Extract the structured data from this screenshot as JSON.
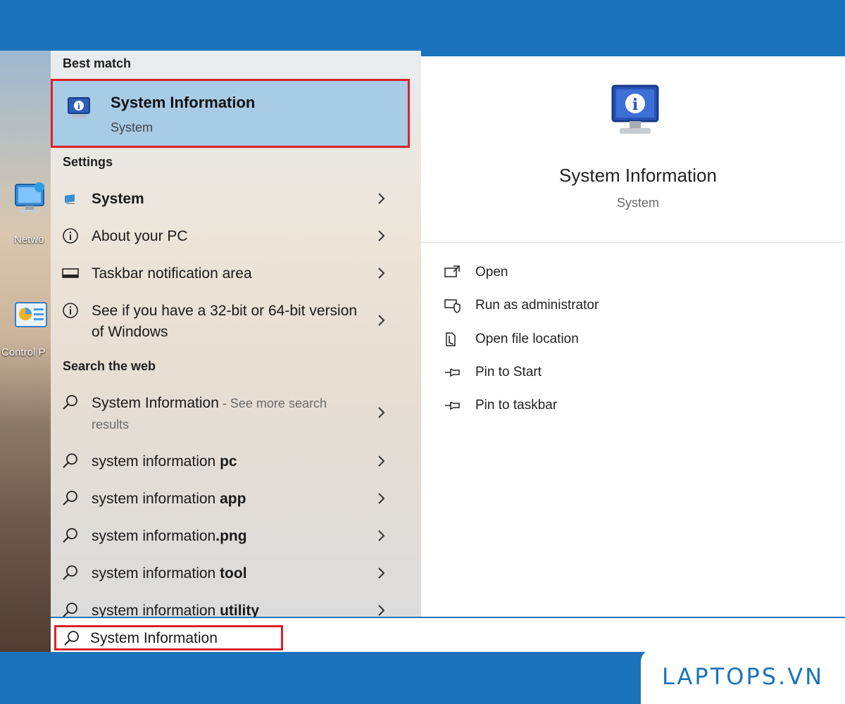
{
  "desktop": {
    "icons": [
      {
        "label": "Netwo",
        "icon": "network-icon"
      },
      {
        "label": "Control P",
        "icon": "control-panel-icon"
      }
    ]
  },
  "results": {
    "best_match_title": "Best match",
    "best_match": {
      "title": "System Information",
      "subtitle": "System",
      "icon": "system-information-icon"
    },
    "settings_title": "Settings",
    "settings": [
      {
        "label": "System",
        "icon": "system-display-icon"
      },
      {
        "label": "About your PC",
        "icon": "info-icon"
      },
      {
        "label": "Taskbar notification area",
        "icon": "taskbar-icon"
      },
      {
        "label": "See if you have a 32-bit or 64-bit version of Windows",
        "icon": "info-icon"
      }
    ],
    "web_title": "Search the web",
    "web": [
      {
        "prefix": "System Information",
        "suffix": " - See more search results"
      },
      {
        "prefix": "system information ",
        "bold": "pc"
      },
      {
        "prefix": "system information ",
        "bold": "app"
      },
      {
        "prefix": "system information",
        "bold": ".png"
      },
      {
        "prefix": "system information ",
        "bold": "tool"
      },
      {
        "prefix": "system information ",
        "bold": "utility"
      }
    ]
  },
  "preview": {
    "title": "System Information",
    "subtitle": "System",
    "actions": [
      {
        "label": "Open",
        "icon": "open-icon"
      },
      {
        "label": "Run as administrator",
        "icon": "run-as-admin-icon"
      },
      {
        "label": "Open file location",
        "icon": "file-location-icon"
      },
      {
        "label": "Pin to Start",
        "icon": "pin-icon"
      },
      {
        "label": "Pin to taskbar",
        "icon": "pin-icon"
      }
    ]
  },
  "search": {
    "value": "System Information"
  },
  "brand": {
    "logo": "LAPTOPS.VN"
  },
  "colors": {
    "frame_blue": "#1b74bb",
    "highlight": "#a8cbe6",
    "annotation_red": "#d9222a"
  }
}
